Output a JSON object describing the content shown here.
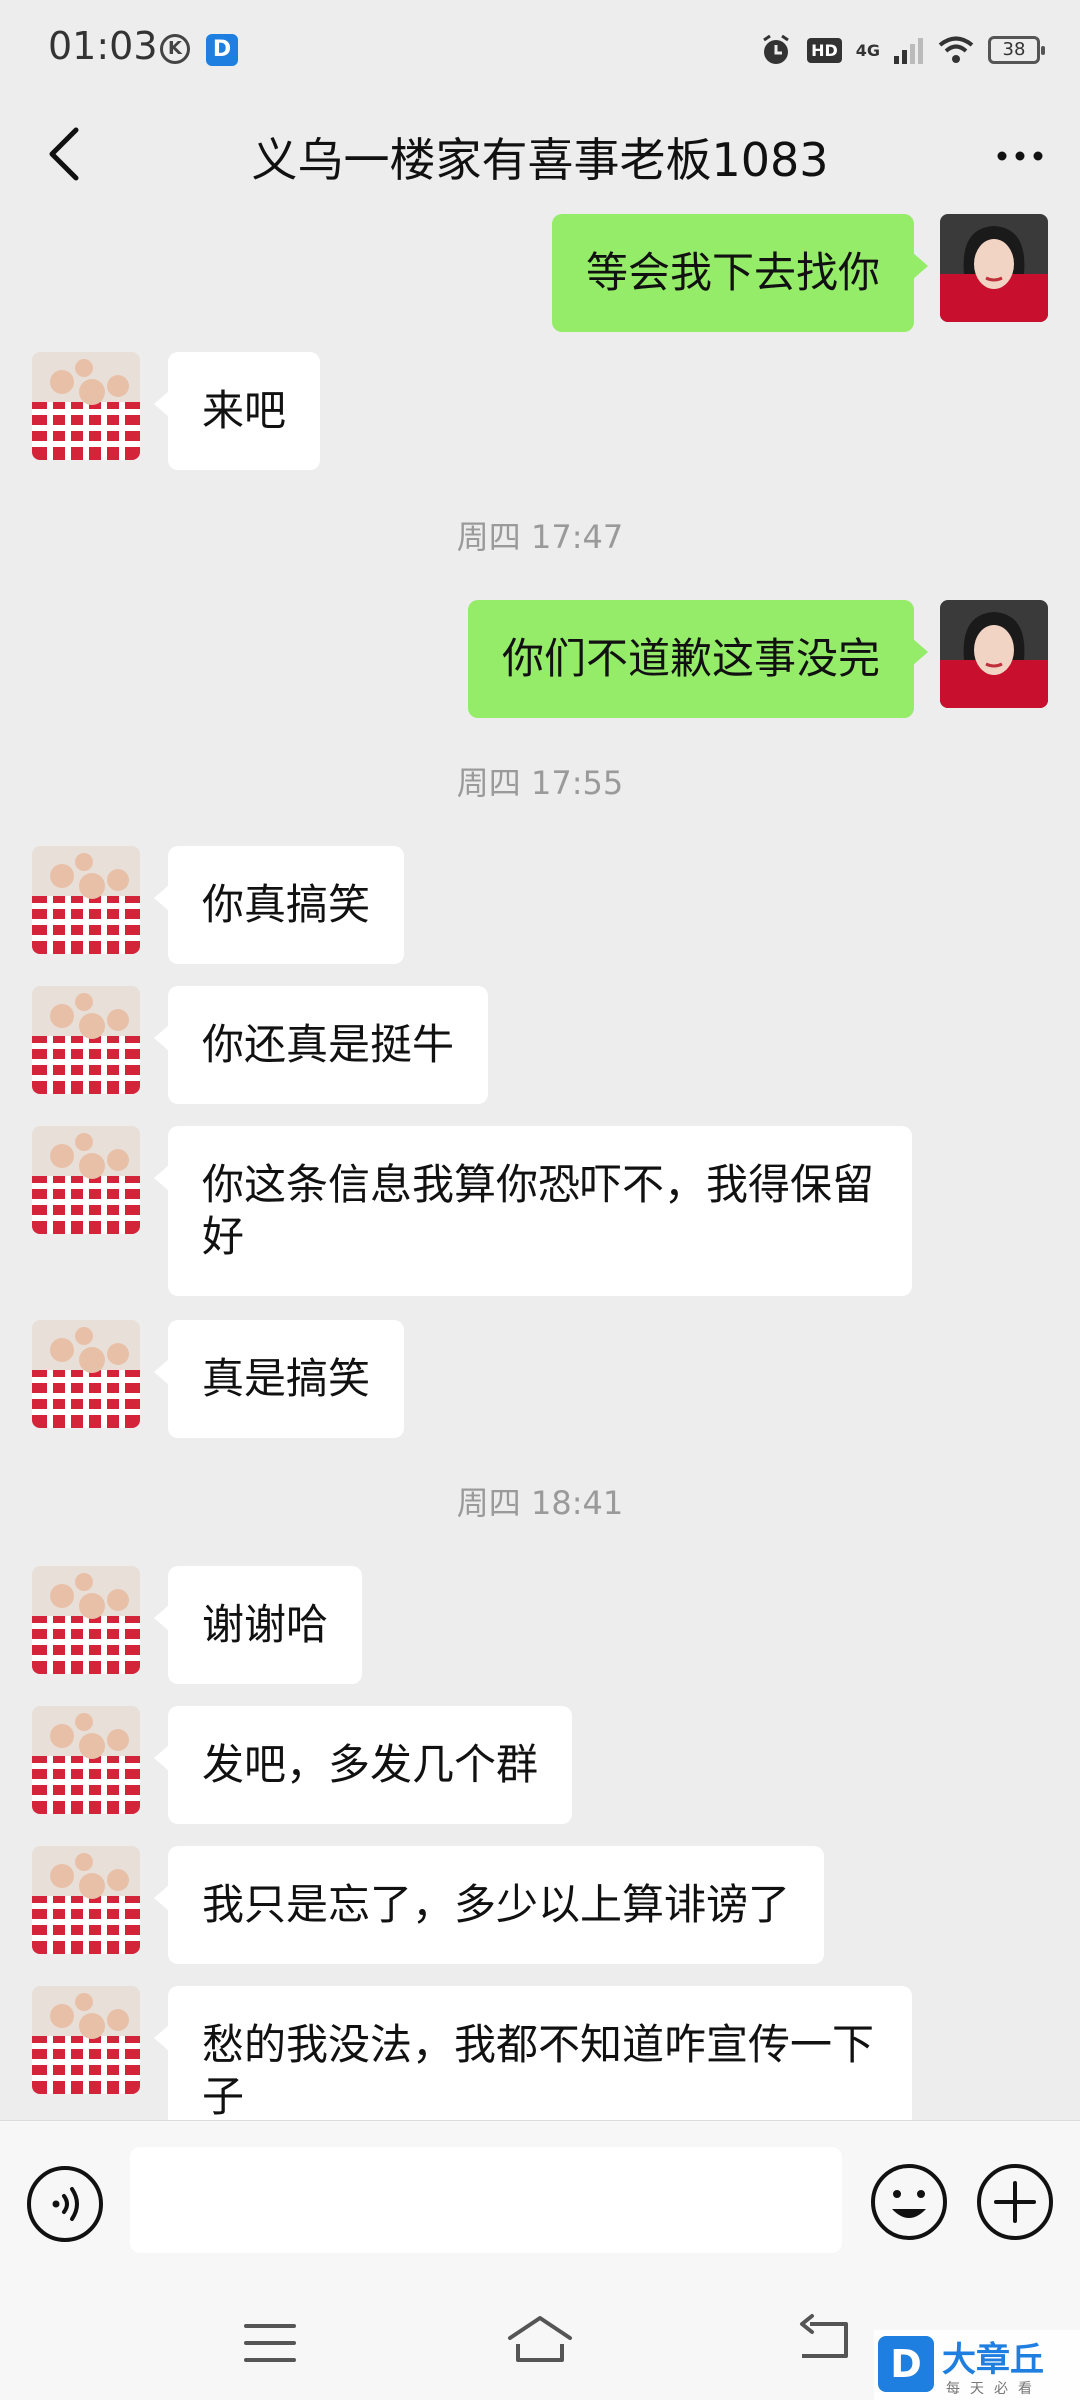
{
  "status_bar": {
    "time": "01:03",
    "k_icon": "K",
    "d_icon": "D",
    "hd": "HD",
    "network": "4G",
    "battery": "38"
  },
  "header": {
    "title": "义乌一楼家有喜事老板1083"
  },
  "messages": [
    {
      "type": "out",
      "text": "等会我下去找你"
    },
    {
      "type": "in",
      "text": "来吧"
    },
    {
      "type": "time",
      "text": "周四 17:47"
    },
    {
      "type": "out",
      "text": "你们不道歉这事没完"
    },
    {
      "type": "time",
      "text": "周四 17:55"
    },
    {
      "type": "in",
      "text": "你真搞笑"
    },
    {
      "type": "in",
      "text": "你还真是挺牛"
    },
    {
      "type": "in",
      "text": "你这条信息我算你恐吓不，我得保留好"
    },
    {
      "type": "in",
      "text": "真是搞笑"
    },
    {
      "type": "time",
      "text": "周四 18:41"
    },
    {
      "type": "in",
      "text": "谢谢哈"
    },
    {
      "type": "in",
      "text": "发吧，多发几个群"
    },
    {
      "type": "in",
      "text": "我只是忘了，多少以上算诽谤了"
    },
    {
      "type": "in",
      "text": "愁的我没法，我都不知道咋宣传一下子"
    }
  ],
  "input": {
    "value": "",
    "placeholder": ""
  },
  "watermark": {
    "logo": "D",
    "name": "大章丘",
    "slogan": "每天必看"
  },
  "colors": {
    "background": "#ededed",
    "bubble_out": "#95ec69",
    "bubble_in": "#ffffff"
  }
}
